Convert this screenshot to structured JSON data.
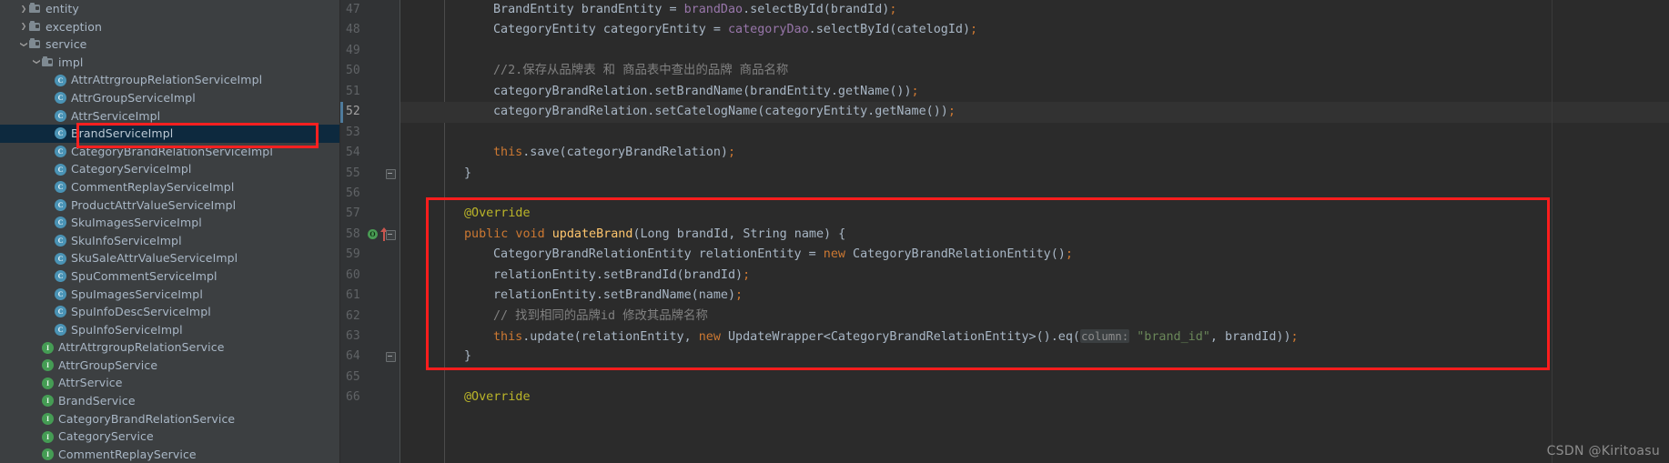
{
  "app": {
    "theme_bg": "#2b2b2b",
    "panel_bg": "#3c3f41",
    "gutter_bg": "#313335",
    "accent_red": "#fb1d1d",
    "selection_bg": "#0d293e"
  },
  "project_tree": {
    "rows": [
      {
        "indent": 1,
        "twisty": "right",
        "icon": "folder-icon",
        "label": "entity",
        "selected": false
      },
      {
        "indent": 1,
        "twisty": "right",
        "icon": "folder-icon",
        "label": "exception",
        "selected": false
      },
      {
        "indent": 1,
        "twisty": "down",
        "icon": "folder-icon",
        "label": "service",
        "selected": false
      },
      {
        "indent": 2,
        "twisty": "down",
        "icon": "folder-icon",
        "label": "impl",
        "selected": false
      },
      {
        "indent": 3,
        "twisty": "none",
        "icon": "class-icon",
        "label": "AttrAttrgroupRelationServiceImpl",
        "selected": false
      },
      {
        "indent": 3,
        "twisty": "none",
        "icon": "class-icon",
        "label": "AttrGroupServiceImpl",
        "selected": false
      },
      {
        "indent": 3,
        "twisty": "none",
        "icon": "class-icon",
        "label": "AttrServiceImpl",
        "selected": false
      },
      {
        "indent": 3,
        "twisty": "none",
        "icon": "class-icon",
        "label": "BrandServiceImpl",
        "selected": true
      },
      {
        "indent": 3,
        "twisty": "none",
        "icon": "class-icon",
        "label": "CategoryBrandRelationServiceImpl",
        "selected": false
      },
      {
        "indent": 3,
        "twisty": "none",
        "icon": "class-icon",
        "label": "CategoryServiceImpl",
        "selected": false
      },
      {
        "indent": 3,
        "twisty": "none",
        "icon": "class-icon",
        "label": "CommentReplayServiceImpl",
        "selected": false
      },
      {
        "indent": 3,
        "twisty": "none",
        "icon": "class-icon",
        "label": "ProductAttrValueServiceImpl",
        "selected": false
      },
      {
        "indent": 3,
        "twisty": "none",
        "icon": "class-icon",
        "label": "SkuImagesServiceImpl",
        "selected": false
      },
      {
        "indent": 3,
        "twisty": "none",
        "icon": "class-icon",
        "label": "SkuInfoServiceImpl",
        "selected": false
      },
      {
        "indent": 3,
        "twisty": "none",
        "icon": "class-icon",
        "label": "SkuSaleAttrValueServiceImpl",
        "selected": false
      },
      {
        "indent": 3,
        "twisty": "none",
        "icon": "class-icon",
        "label": "SpuCommentServiceImpl",
        "selected": false
      },
      {
        "indent": 3,
        "twisty": "none",
        "icon": "class-icon",
        "label": "SpuImagesServiceImpl",
        "selected": false
      },
      {
        "indent": 3,
        "twisty": "none",
        "icon": "class-icon",
        "label": "SpuInfoDescServiceImpl",
        "selected": false
      },
      {
        "indent": 3,
        "twisty": "none",
        "icon": "class-icon",
        "label": "SpuInfoServiceImpl",
        "selected": false
      },
      {
        "indent": 2,
        "twisty": "none",
        "icon": "interface-icon",
        "label": "AttrAttrgroupRelationService",
        "selected": false
      },
      {
        "indent": 2,
        "twisty": "none",
        "icon": "interface-icon",
        "label": "AttrGroupService",
        "selected": false
      },
      {
        "indent": 2,
        "twisty": "none",
        "icon": "interface-icon",
        "label": "AttrService",
        "selected": false
      },
      {
        "indent": 2,
        "twisty": "none",
        "icon": "interface-icon",
        "label": "BrandService",
        "selected": false
      },
      {
        "indent": 2,
        "twisty": "none",
        "icon": "interface-icon",
        "label": "CategoryBrandRelationService",
        "selected": false
      },
      {
        "indent": 2,
        "twisty": "none",
        "icon": "interface-icon",
        "label": "CategoryService",
        "selected": false
      },
      {
        "indent": 2,
        "twisty": "none",
        "icon": "interface-icon",
        "label": "CommentReplayService",
        "selected": false
      }
    ],
    "highlight_box_label": "CategoryBrandRelationServiceImpl"
  },
  "editor": {
    "gutter": [
      {
        "num": "47",
        "current": false,
        "fold": null,
        "marker": null
      },
      {
        "num": "48",
        "current": false,
        "fold": null,
        "marker": null
      },
      {
        "num": "49",
        "current": false,
        "fold": null,
        "marker": null
      },
      {
        "num": "50",
        "current": false,
        "fold": null,
        "marker": null
      },
      {
        "num": "51",
        "current": false,
        "fold": null,
        "marker": null
      },
      {
        "num": "52",
        "current": true,
        "fold": null,
        "marker": null
      },
      {
        "num": "53",
        "current": false,
        "fold": null,
        "marker": null
      },
      {
        "num": "54",
        "current": false,
        "fold": null,
        "marker": null
      },
      {
        "num": "55",
        "current": false,
        "fold": "open",
        "marker": null
      },
      {
        "num": "56",
        "current": false,
        "fold": null,
        "marker": null
      },
      {
        "num": "57",
        "current": false,
        "fold": null,
        "marker": null
      },
      {
        "num": "58",
        "current": false,
        "fold": "open",
        "marker": "implementing-method-icon"
      },
      {
        "num": "59",
        "current": false,
        "fold": null,
        "marker": null
      },
      {
        "num": "60",
        "current": false,
        "fold": null,
        "marker": null
      },
      {
        "num": "61",
        "current": false,
        "fold": null,
        "marker": null
      },
      {
        "num": "62",
        "current": false,
        "fold": null,
        "marker": null
      },
      {
        "num": "63",
        "current": false,
        "fold": null,
        "marker": null
      },
      {
        "num": "64",
        "current": false,
        "fold": "open",
        "marker": null
      },
      {
        "num": "65",
        "current": false,
        "fold": null,
        "marker": null
      },
      {
        "num": "66",
        "current": false,
        "fold": null,
        "marker": null
      }
    ],
    "lines": [
      {
        "indent": 2,
        "current": false,
        "tokens": [
          {
            "t": "plain",
            "v": "BrandEntity brandEntity = "
          },
          {
            "t": "field",
            "v": "brandDao"
          },
          {
            "t": "plain",
            "v": ".selectById(brandId)"
          },
          {
            "t": "semi",
            "v": ";"
          }
        ]
      },
      {
        "indent": 2,
        "current": false,
        "tokens": [
          {
            "t": "plain",
            "v": "CategoryEntity categoryEntity = "
          },
          {
            "t": "field",
            "v": "categoryDao"
          },
          {
            "t": "plain",
            "v": ".selectById(catelogId)"
          },
          {
            "t": "semi",
            "v": ";"
          }
        ]
      },
      {
        "indent": 2,
        "current": false,
        "tokens": []
      },
      {
        "indent": 2,
        "current": false,
        "tokens": [
          {
            "t": "cmt",
            "v": "//2.保存从品牌表 和 商品表中查出的品牌 商品名称"
          }
        ]
      },
      {
        "indent": 2,
        "current": false,
        "tokens": [
          {
            "t": "plain",
            "v": "categoryBrandRelation.setBrandName(brandEntity.getName())"
          },
          {
            "t": "semi",
            "v": ";"
          }
        ]
      },
      {
        "indent": 2,
        "current": true,
        "tokens": [
          {
            "t": "plain",
            "v": "categoryBrandRelation.setCatelogName(categoryEntity.getName())"
          },
          {
            "t": "semi",
            "v": ";"
          }
        ]
      },
      {
        "indent": 2,
        "current": false,
        "tokens": []
      },
      {
        "indent": 2,
        "current": false,
        "tokens": [
          {
            "t": "kw",
            "v": "this"
          },
          {
            "t": "plain",
            "v": ".save(categoryBrandRelation)"
          },
          {
            "t": "semi",
            "v": ";"
          }
        ]
      },
      {
        "indent": 1,
        "current": false,
        "tokens": [
          {
            "t": "plain",
            "v": "}"
          }
        ]
      },
      {
        "indent": 0,
        "current": false,
        "tokens": []
      },
      {
        "indent": 1,
        "current": false,
        "tokens": [
          {
            "t": "anno",
            "v": "@Override"
          }
        ]
      },
      {
        "indent": 1,
        "current": false,
        "tokens": [
          {
            "t": "kw",
            "v": "public void "
          },
          {
            "t": "method",
            "v": "updateBrand"
          },
          {
            "t": "plain",
            "v": "(Long brandId, String name) {"
          }
        ]
      },
      {
        "indent": 2,
        "current": false,
        "tokens": [
          {
            "t": "plain",
            "v": "CategoryBrandRelationEntity relationEntity = "
          },
          {
            "t": "kw",
            "v": "new "
          },
          {
            "t": "plain",
            "v": "CategoryBrandRelationEntity()"
          },
          {
            "t": "semi",
            "v": ";"
          }
        ]
      },
      {
        "indent": 2,
        "current": false,
        "tokens": [
          {
            "t": "plain",
            "v": "relationEntity.setBrandId(brandId)"
          },
          {
            "t": "semi",
            "v": ";"
          }
        ]
      },
      {
        "indent": 2,
        "current": false,
        "tokens": [
          {
            "t": "plain",
            "v": "relationEntity.setBrandName(name)"
          },
          {
            "t": "semi",
            "v": ";"
          }
        ]
      },
      {
        "indent": 2,
        "current": false,
        "tokens": [
          {
            "t": "cmt",
            "v": "// 找到相同的品牌id 修改其品牌名称"
          }
        ]
      },
      {
        "indent": 2,
        "current": false,
        "tokens": [
          {
            "t": "kw",
            "v": "this"
          },
          {
            "t": "plain",
            "v": ".update(relationEntity, "
          },
          {
            "t": "kw",
            "v": "new "
          },
          {
            "t": "plain",
            "v": "UpdateWrapper<CategoryBrandRelationEntity>().eq("
          },
          {
            "t": "hint",
            "v": "column:"
          },
          {
            "t": "plain",
            "v": " "
          },
          {
            "t": "str",
            "v": "\"brand_id\""
          },
          {
            "t": "plain",
            "v": ", brandId))"
          },
          {
            "t": "semi",
            "v": ";"
          }
        ]
      },
      {
        "indent": 1,
        "current": false,
        "tokens": [
          {
            "t": "plain",
            "v": "}"
          }
        ]
      },
      {
        "indent": 0,
        "current": false,
        "tokens": []
      },
      {
        "indent": 1,
        "current": false,
        "tokens": [
          {
            "t": "anno",
            "v": "@Override"
          }
        ]
      }
    ],
    "highlight_box_label": "updateBrand method block"
  },
  "watermark": {
    "text": "CSDN @Kiritoasu"
  }
}
